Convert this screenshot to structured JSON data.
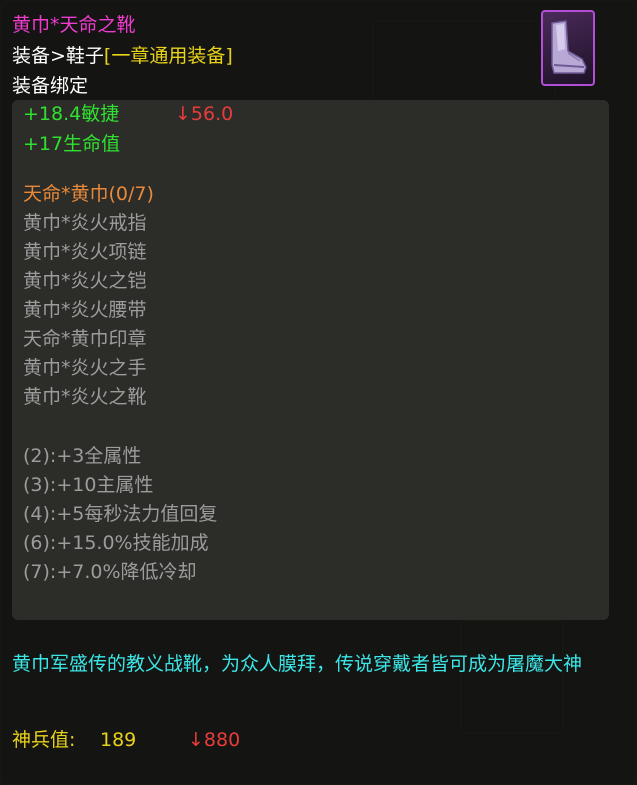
{
  "item": {
    "name": "黄巾*天命之靴",
    "category": "装备>鞋子",
    "category_tag": "[一章通用装备]",
    "binding": "装备绑定",
    "icon": "boots-icon"
  },
  "stats": {
    "agility": "+18.4敏捷",
    "agility_compare": "↓56.0",
    "hp": "+17生命值"
  },
  "set": {
    "name": "天命*黄巾(0/7)",
    "pieces": [
      "黄巾*炎火戒指",
      "黄巾*炎火项链",
      "黄巾*炎火之铠",
      "黄巾*炎火腰带",
      "天命*黄巾印章",
      "黄巾*炎火之手",
      "黄巾*炎火之靴"
    ],
    "bonuses": [
      "(2):+3全属性",
      "(3):+10主属性",
      "(4):+5每秒法力值回复",
      "(6):+15.0%技能加成",
      "(7):+7.0%降低冷却"
    ]
  },
  "description": "黄巾军盛传的教义战靴，为众人膜拜，传说穿戴者皆可成为屠魔大神",
  "score": {
    "label": "神兵值:",
    "value": "189",
    "compare": "↓880"
  },
  "colors": {
    "title": "#ee3ccf",
    "tag": "#e9d21a",
    "stat": "#30e030",
    "decrease": "#e83c3c",
    "set_name": "#e88a3a",
    "inactive": "#9c9c9c",
    "description": "#3ce6e6"
  }
}
